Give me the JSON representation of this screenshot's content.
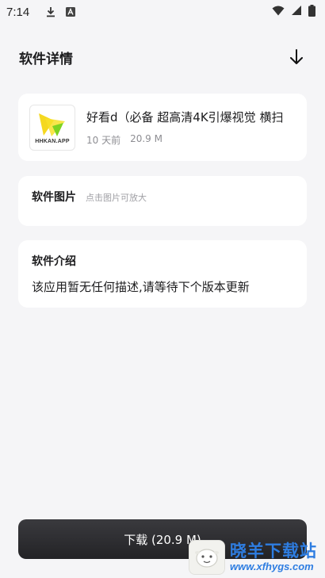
{
  "status_bar": {
    "time": "7:14",
    "left_icons": [
      "download-icon",
      "keyboard-a-icon"
    ],
    "right_icons": [
      "wifi-icon",
      "signal-icon",
      "battery-icon"
    ]
  },
  "header": {
    "title": "软件详情",
    "action_icon": "arrow-down-icon"
  },
  "app": {
    "icon_brand": "HHKAN.APP",
    "name": "好看d（必备 超高清4K引爆视觉 横扫",
    "updated": "10 天前",
    "size": "20.9 M"
  },
  "images_section": {
    "title": "软件图片",
    "hint": "点击图片可放大"
  },
  "intro_section": {
    "title": "软件介绍",
    "text": "该应用暂无任何描述,请等待下个版本更新"
  },
  "download_button": {
    "label": "下载 (20.9 M)"
  },
  "watermark": {
    "name": "晓羊下载站",
    "url": "www.xfhygs.com"
  },
  "colors": {
    "background": "#f5f5f7",
    "card": "#ffffff",
    "button": "#2a2a2d",
    "watermark": "#2e7de1",
    "app_icon_yellow": "#f5d820",
    "app_icon_green": "#7ed321"
  }
}
